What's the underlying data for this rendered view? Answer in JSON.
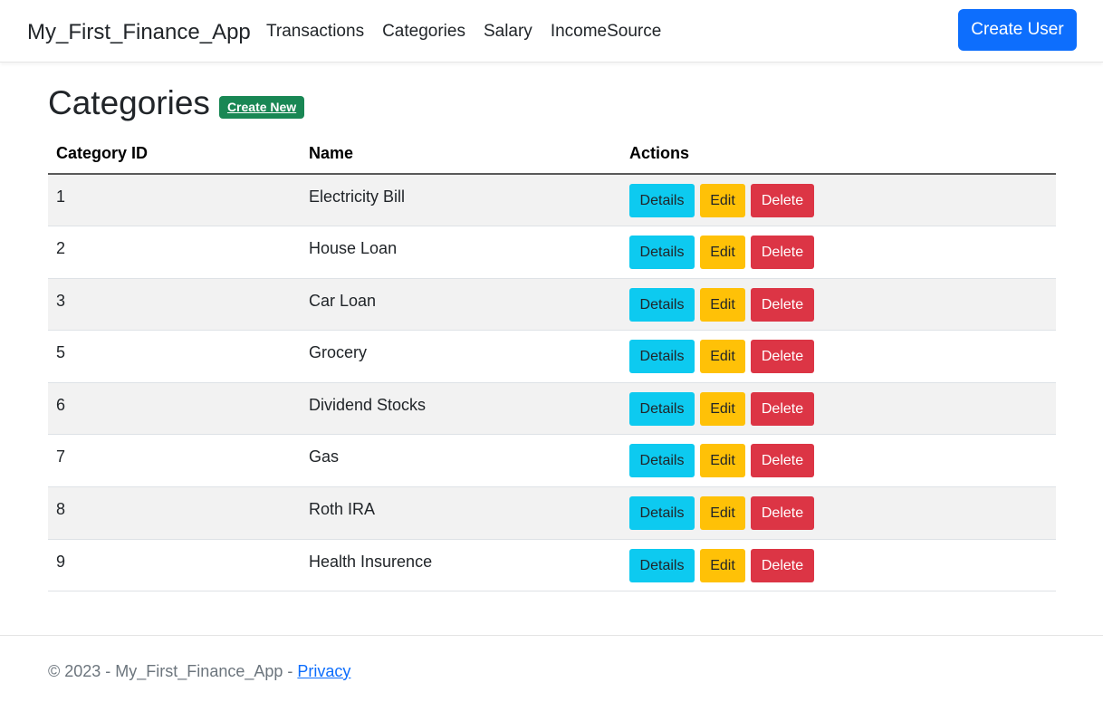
{
  "navbar": {
    "brand": "My_First_Finance_App",
    "links": [
      "Transactions",
      "Categories",
      "Salary",
      "IncomeSource"
    ],
    "create_user_label": "Create User"
  },
  "page": {
    "title": "Categories",
    "create_new_label": "Create New"
  },
  "table": {
    "headers": [
      "Category ID",
      "Name",
      "Actions"
    ],
    "rows": [
      {
        "id": "1",
        "name": "Electricity Bill"
      },
      {
        "id": "2",
        "name": "House Loan"
      },
      {
        "id": "3",
        "name": "Car Loan"
      },
      {
        "id": "5",
        "name": "Grocery"
      },
      {
        "id": "6",
        "name": "Dividend Stocks"
      },
      {
        "id": "7",
        "name": "Gas"
      },
      {
        "id": "8",
        "name": "Roth IRA"
      },
      {
        "id": "9",
        "name": "Health Insurence"
      }
    ],
    "actions": {
      "details": "Details",
      "edit": "Edit",
      "delete": "Delete"
    }
  },
  "footer": {
    "text": "© 2023 - My_First_Finance_App - ",
    "privacy_label": "Privacy"
  },
  "colors": {
    "primary": "#0d6efd",
    "success": "#198754",
    "info": "#0dcaf0",
    "warning": "#ffc107",
    "danger": "#dc3545"
  }
}
